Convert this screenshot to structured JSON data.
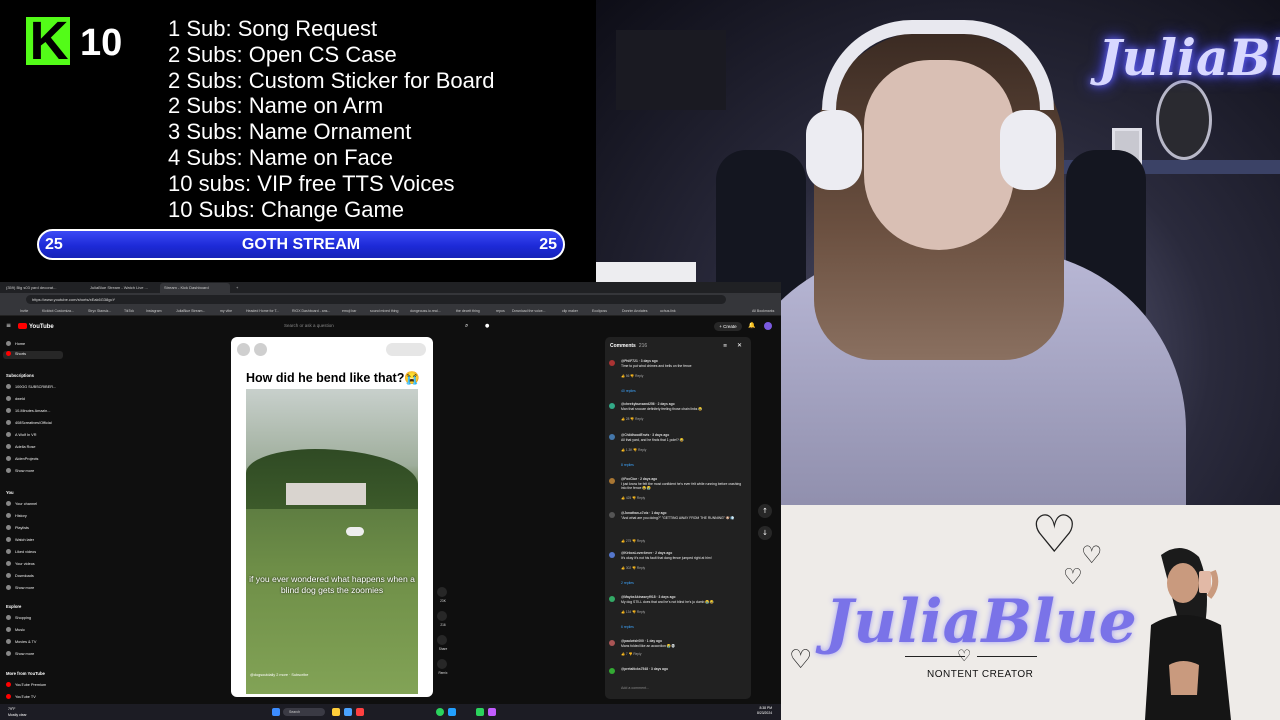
{
  "overlay": {
    "kick_letter": "K",
    "kick_count": "10",
    "sub_goals": [
      "1 Sub: Song Request",
      "2 Subs: Open CS Case",
      "2 Subs: Custom Sticker for Board",
      "2 Subs: Name on Arm",
      "3 Subs: Name Ornament",
      "4 Subs: Name on Face",
      "10 subs: VIP free TTS Voices",
      "10 Subs: Change Game"
    ],
    "goal_bar": {
      "left": "25",
      "title": "GOTH STREAM",
      "right": "25",
      "progress": 1.0
    },
    "colors": {
      "kick_green": "#53fc18",
      "goal_blue": "#1d2ad8"
    }
  },
  "webcam": {
    "neon_sign": "JuliaBlu"
  },
  "brand": {
    "name": "JuliaBlue",
    "tagline": "NONTENT CREATOR",
    "accent": "#7a73e8"
  },
  "browser": {
    "tabs": [
      "(359) Big s03 yard decorat...",
      "JuliaBlue Stream - Watch Live ...",
      "Stream - Kick Dashboard"
    ],
    "address": "https://www.youtube.com/shorts/xEak6G38gcY",
    "bookmarks": [
      "Invite",
      "Kickbot Customiza...",
      "Stryx Stansiz...",
      "TikTok",
      "Instagram",
      "JuliaBlue Stream...",
      "my vibe",
      "Headed Home for T...",
      "RIOX Dashboard - ans...",
      "emoji bar",
      "sound mixed thing",
      "dungeouss.io.real...",
      "the deceit thing",
      "repos",
      "Download the voice...",
      "clip maker",
      "Ecoliposs",
      "Donrim Anxiates",
      "uchus.link",
      "All Bookmarks"
    ]
  },
  "youtube": {
    "logo": "YouTube",
    "search_placeholder": "Search or ask a question",
    "create_label": "+ Create",
    "sidebar_top": [
      "Home",
      "Shorts"
    ],
    "subscriptions_heading": "Subscriptions",
    "subscriptions": [
      "100GG SUBSCRIBER...",
      "dweld",
      "10-Minutes Amazin...",
      "408Screatives/Official",
      "A Wolf In VR",
      "Adella Rose",
      "AidenProjects",
      "Show more"
    ],
    "you_heading": "You",
    "you_items": [
      "Your channel",
      "History",
      "Playlists",
      "Watch later",
      "Liked videos",
      "Your videos",
      "Downloads",
      "Show more"
    ],
    "explore_heading": "Explore",
    "explore_items": [
      "Shopping",
      "Music",
      "Movies & TV",
      "Show more"
    ],
    "more_heading": "More from YouTube",
    "more_items": [
      "YouTube Premium",
      "YouTube TV"
    ],
    "short": {
      "title": "How did he bend like that?😭",
      "caption": "if you ever wondered what happens when a blind dog gets the zoomies",
      "channel": "@dogsoutdaily 2 more · Subscribe",
      "actions": [
        {
          "icon": "like-icon",
          "label": "23K"
        },
        {
          "icon": "comment-icon",
          "label": "216"
        },
        {
          "icon": "share-icon",
          "label": "Share"
        },
        {
          "icon": "remix-icon",
          "label": "Remix"
        }
      ]
    },
    "comments": {
      "title": "Comments",
      "count": "216",
      "add_placeholder": "Add a comment...",
      "items": [
        {
          "user": "@PhilF721 · 3 days ago",
          "text": "Time to put wind chimes and bells on the fence",
          "meta": "👍 56  👎  Reply",
          "replies": "40 replies"
        },
        {
          "user": "@cheekybunsand256 · 2 days ago",
          "text": "Man that snooze definitely feeling those chain links 😂",
          "meta": "👍 28  👎  Reply",
          "replies": ""
        },
        {
          "user": "@ChildhoodEnvis · 3 days ago",
          "text": "All that yard, and he finds that 1 pole!? 😂",
          "meta": "👍 1.3K  👎  Reply",
          "replies": "8 replies"
        },
        {
          "user": "@FoxCloe · 2 days ago",
          "text": "I just know he felt the most confident he's ever felt while running before crashing into the fence 😂😭",
          "meta": "👍 425  👎  Reply",
          "replies": ""
        },
        {
          "user": "@Jonathan-c7otz · 1 day ago",
          "text": "\"And what are you doing?\"\n\"GETTING AWAY FROM THE RUNNING\" 🐶💨",
          "meta": "👍 275  👎  Reply",
          "replies": ""
        },
        {
          "user": "@KirbosLover4ever · 2 days ago",
          "text": "It's okay it's not his fault that dang fence jumped right at him!",
          "meta": "👍 302  👎  Reply",
          "replies": "2 replies"
        },
        {
          "user": "@MaybeAkinaseyf918 · 3 days ago",
          "text": "My dog STILL does that and he's not blind he's ju dumb 😭😂",
          "meta": "👍 134  👎  Reply",
          "replies": "6 replies"
        },
        {
          "user": "@paulwish000 · 1 day ago",
          "text": "Mans folded like an accordion 😭💀",
          "meta": "👍 7  👎  Reply",
          "replies": ""
        },
        {
          "user": "@pretalticks7548 · 3 days ago",
          "text": "",
          "meta": "",
          "replies": ""
        }
      ]
    }
  },
  "taskbar": {
    "weather": "79°F\nMostly clear",
    "search": "Search",
    "clock": "8:38 PM\n8/23/2024",
    "icon_colors": [
      "#3c8cff",
      "#ffce3a",
      "#4aa3ff",
      "#ff4040",
      "#2bd35d",
      "#22a0ff",
      "#c25cff",
      "#ffffff"
    ]
  }
}
